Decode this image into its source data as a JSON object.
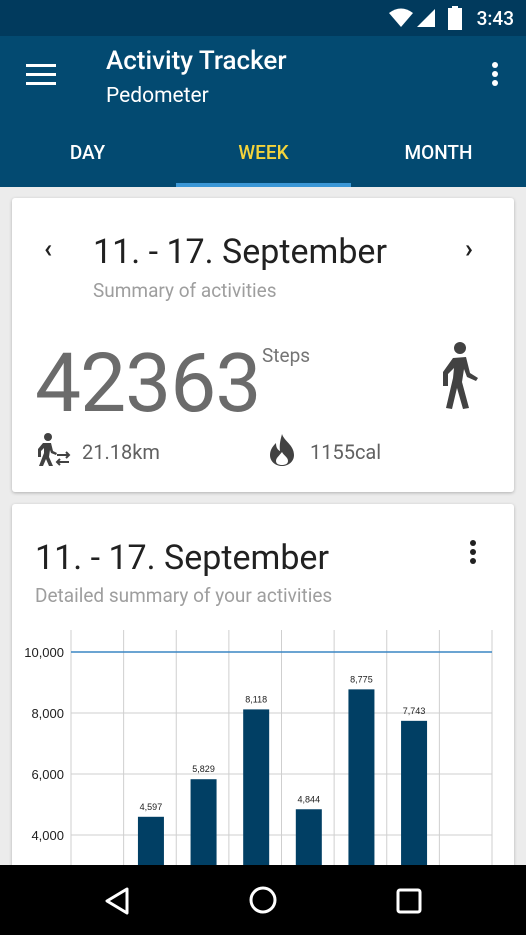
{
  "status_bar": {
    "time": "3:43",
    "icons": [
      "wifi-icon",
      "cell-signal-icon",
      "battery-icon"
    ]
  },
  "toolbar": {
    "title": "Activity Tracker",
    "subtitle": "Pedometer",
    "menu_icon": "hamburger-menu-icon",
    "more_icon": "more-vert-icon"
  },
  "tabs": [
    {
      "label": "DAY",
      "active": false
    },
    {
      "label": "WEEK",
      "active": true
    },
    {
      "label": "MONTH",
      "active": false
    }
  ],
  "summary": {
    "date_range": "11. - 17. September",
    "subtitle": "Summary of activities",
    "prev_icon": "chevron-left-icon",
    "next_icon": "chevron-right-icon",
    "steps": "42363",
    "steps_label": "Steps",
    "distance": "21.18km",
    "calories": "1155cal"
  },
  "detail": {
    "date_range": "11. - 17. September",
    "subtitle": "Detailed summary of your activities"
  },
  "chart_data": {
    "type": "bar",
    "categories": [
      "",
      "",
      "",
      "",
      "",
      "",
      ""
    ],
    "values": [
      null,
      null,
      4597,
      5829,
      8118,
      4844,
      8775,
      7743
    ],
    "value_labels": [
      "4,597",
      "5,829",
      "8,118",
      "4,844",
      "8,775",
      "7,743"
    ],
    "bar_values": [
      4597,
      5829,
      8118,
      4844,
      8775,
      7743
    ],
    "ytick_labels": [
      "10,000",
      "8,000",
      "6,000",
      "4,000"
    ],
    "yticks": [
      10000,
      8000,
      6000,
      4000
    ],
    "goal_line": 10000,
    "bar_color": "#013f64",
    "goal_line_color": "#3a86c4"
  },
  "colors": {
    "primary": "#034a71",
    "status_bar": "#013a5d",
    "accent": "#f4d43b",
    "tab_indicator": "#3b97d6"
  },
  "nav_bar": {
    "back_icon": "back-triangle-icon",
    "home_icon": "home-circle-icon",
    "recents_icon": "recents-square-icon"
  }
}
